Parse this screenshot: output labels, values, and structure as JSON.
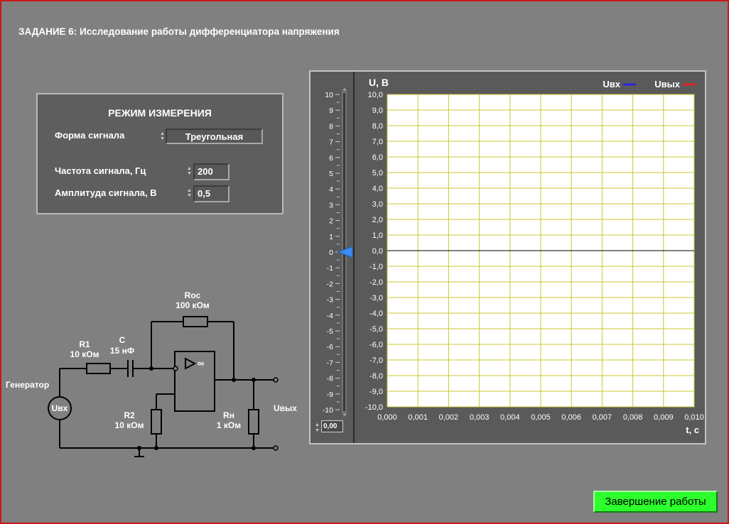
{
  "task_title": "ЗАДАНИЕ 6: Исследование работы дифференциатора напряжения",
  "mode_panel": {
    "title": "РЕЖИМ ИЗМЕРЕНИЯ",
    "waveform_label": "Форма сигнала",
    "waveform_value": "Треугольная",
    "frequency_label": "Частота сигнала, Гц",
    "frequency_value": "200",
    "amplitude_label": "Амплитуда сигнала, В",
    "amplitude_value": "0,5"
  },
  "circuit": {
    "roc_name": "Roc",
    "roc_value": "100 кОм",
    "r1_name": "R1",
    "r1_value": "10 кОм",
    "c_name": "C",
    "c_value": "15 нФ",
    "generator_label": "Генератор",
    "uin_label": "Uвх",
    "r2_name": "R2",
    "r2_value": "10 кОм",
    "rn_name": "Rн",
    "rn_value": "1 кОм",
    "uout_label": "Uвых"
  },
  "slider": {
    "ticks": [
      "10",
      "9",
      "8",
      "7",
      "6",
      "5",
      "4",
      "3",
      "2",
      "1",
      "0",
      "-1",
      "-2",
      "-3",
      "-4",
      "-5",
      "-6",
      "-7",
      "-8",
      "-9",
      "-10"
    ],
    "value": 0,
    "offset_value": "0,00"
  },
  "chart_data": {
    "type": "line",
    "ylabel": "U, B",
    "xlabel": "t, c",
    "xlim": [
      0,
      0.01
    ],
    "ylim": [
      -10,
      10
    ],
    "x_ticks": [
      "0,000",
      "0,001",
      "0,002",
      "0,003",
      "0,004",
      "0,005",
      "0,006",
      "0,007",
      "0,008",
      "0,009",
      "0,010"
    ],
    "y_ticks": [
      "10,0",
      "9,0",
      "8,0",
      "7,0",
      "6,0",
      "5,0",
      "4,0",
      "3,0",
      "2,0",
      "1,0",
      "0,0",
      "-1,0",
      "-2,0",
      "-3,0",
      "-4,0",
      "-5,0",
      "-6,0",
      "-7,0",
      "-8,0",
      "-9,0",
      "-10,0"
    ],
    "grid": true,
    "legend_position": "top-right",
    "series": [
      {
        "name": "Uвх",
        "color": "#2828d8",
        "values": []
      },
      {
        "name": "Uвых",
        "color": "#e02020",
        "values": []
      }
    ],
    "zero_line_color": "#000000",
    "grid_color": "#c8c832"
  },
  "finish_button_label": "Завершение работы"
}
